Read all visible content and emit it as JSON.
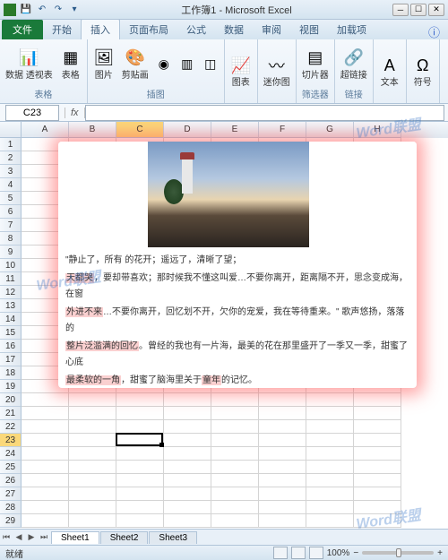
{
  "titlebar": {
    "app_title": "工作簿1 - Microsoft Excel"
  },
  "tabs": {
    "file": "文件",
    "items": [
      "开始",
      "插入",
      "页面布局",
      "公式",
      "数据",
      "审阅",
      "视图",
      "加载项"
    ],
    "active_index": 1
  },
  "ribbon": {
    "groups": [
      {
        "label": "表格",
        "items": [
          {
            "label": "数据\n透视表",
            "glyph": "📊"
          },
          {
            "label": "表格",
            "glyph": "▦"
          }
        ]
      },
      {
        "label": "插图",
        "items": [
          {
            "label": "图片",
            "glyph": "🖼"
          },
          {
            "label": "剪贴画",
            "glyph": "🎨"
          },
          {
            "label": "",
            "glyph": "◉",
            "sm": true
          },
          {
            "label": "",
            "glyph": "▥",
            "sm": true
          },
          {
            "label": "",
            "glyph": "◫",
            "sm": true
          }
        ]
      },
      {
        "label": "",
        "items": [
          {
            "label": "图表",
            "glyph": "📈"
          }
        ]
      },
      {
        "label": "",
        "items": [
          {
            "label": "迷你图",
            "glyph": "〰"
          }
        ]
      },
      {
        "label": "筛选器",
        "items": [
          {
            "label": "切片器",
            "glyph": "▤"
          }
        ]
      },
      {
        "label": "链接",
        "items": [
          {
            "label": "超链接",
            "glyph": "🔗"
          }
        ]
      },
      {
        "label": "",
        "items": [
          {
            "label": "文本",
            "glyph": "A"
          }
        ]
      },
      {
        "label": "",
        "items": [
          {
            "label": "符号",
            "glyph": "Ω"
          }
        ]
      }
    ]
  },
  "formula_bar": {
    "name_box": "C23",
    "fx": "fx"
  },
  "columns": [
    "A",
    "B",
    "C",
    "D",
    "E",
    "F",
    "G",
    "H"
  ],
  "row_count": 29,
  "active_cell": {
    "col": 2,
    "row": 23
  },
  "content_box": {
    "lines": [
      "\"静止了，所有                                                        的花开；遥远了，清晰了望；",
      "天都哭，要却带喜欢；那时候我不懂这叫爱…不要你离开，距离隔不开，思念变成海，在窗",
      "外进不来…不要你离开，回忆划不开，欠你的宠爱，我在等待重来。\"   歌声悠扬，落落的",
      "整片泛滥满的回忆。曾经的我也有一片海，最美的花在那里盛开了一季又一季，甜蜜了心底",
      "最柔软的一角，甜蜜了脑海里关于童年的记忆。"
    ],
    "highlights": [
      "天都哭",
      "外进不来",
      "整片泛滥满的回忆",
      "最柔软的一角",
      "童年"
    ]
  },
  "sheets": {
    "nav": [
      "⏮",
      "◀",
      "▶",
      "⏭"
    ],
    "tabs": [
      "Sheet1",
      "Sheet2",
      "Sheet3"
    ],
    "active": 0
  },
  "status": {
    "text": "就绪",
    "zoom": "100%",
    "zoom_plus": "+",
    "zoom_minus": "−"
  },
  "watermark": "Word联盟"
}
